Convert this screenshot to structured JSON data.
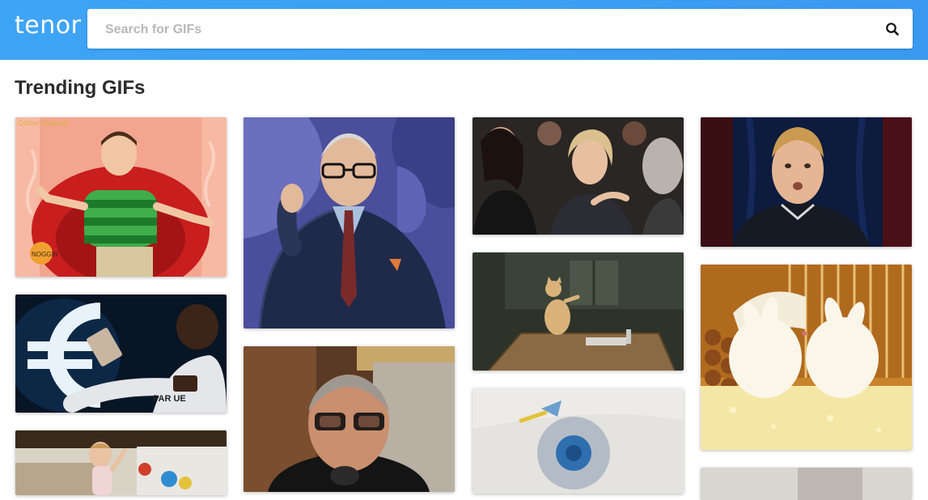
{
  "header": {
    "logo": "tenor",
    "search": {
      "placeholder": "Search for GIFs",
      "value": ""
    },
    "search_icon": "search-icon"
  },
  "main": {
    "title": "Trending GIFs"
  },
  "gifs": [
    {
      "subject": "blues-clues-steve",
      "overlay_text": "Colour Channel"
    },
    {
      "subject": "euro-money-throw"
    },
    {
      "subject": "baby-waving"
    },
    {
      "subject": "tim-gunn-gesture"
    },
    {
      "subject": "jeff-goldblum-glasses"
    },
    {
      "subject": "audience-women-reacting"
    },
    {
      "subject": "cat-on-table"
    },
    {
      "subject": "fidget-spinner"
    },
    {
      "subject": "boy-surprised"
    },
    {
      "subject": "white-bunnies"
    },
    {
      "subject": "partial-gif"
    }
  ],
  "colors": {
    "header_blue": "#3c9ff2",
    "title_text": "#2b2b2b",
    "placeholder": "#b8b8b8"
  }
}
